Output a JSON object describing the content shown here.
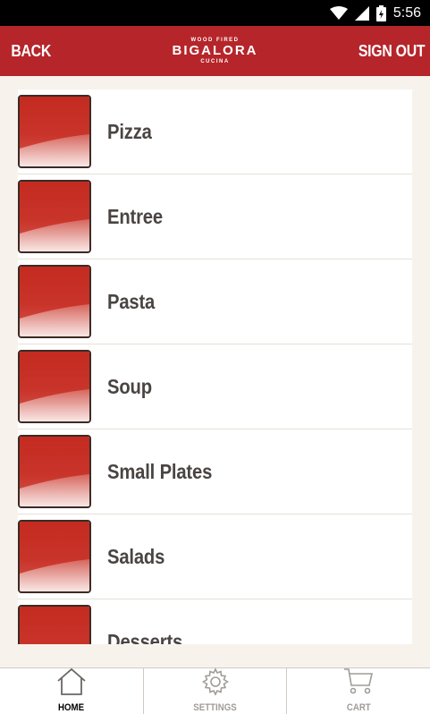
{
  "status_bar": {
    "time": "5:56",
    "icons": [
      "wifi-icon",
      "signal-icon",
      "battery-icon"
    ]
  },
  "header": {
    "back_label": "BACK",
    "logo": {
      "top_text": "WOOD FIRED",
      "brand": "BIGALORA",
      "bottom_text": "CUCINA"
    },
    "signout_label": "SIGN OUT",
    "color": "#b5252a"
  },
  "menu": {
    "items": [
      {
        "label": "Pizza"
      },
      {
        "label": "Entree"
      },
      {
        "label": "Pasta"
      },
      {
        "label": "Soup"
      },
      {
        "label": "Small Plates"
      },
      {
        "label": "Salads"
      },
      {
        "label": "Desserts"
      }
    ]
  },
  "bottom_nav": {
    "tabs": [
      {
        "label": "HOME",
        "icon": "home-icon",
        "active": true
      },
      {
        "label": "SETTINGS",
        "icon": "gear-icon",
        "active": false
      },
      {
        "label": "CART",
        "icon": "cart-icon",
        "active": false
      }
    ]
  }
}
